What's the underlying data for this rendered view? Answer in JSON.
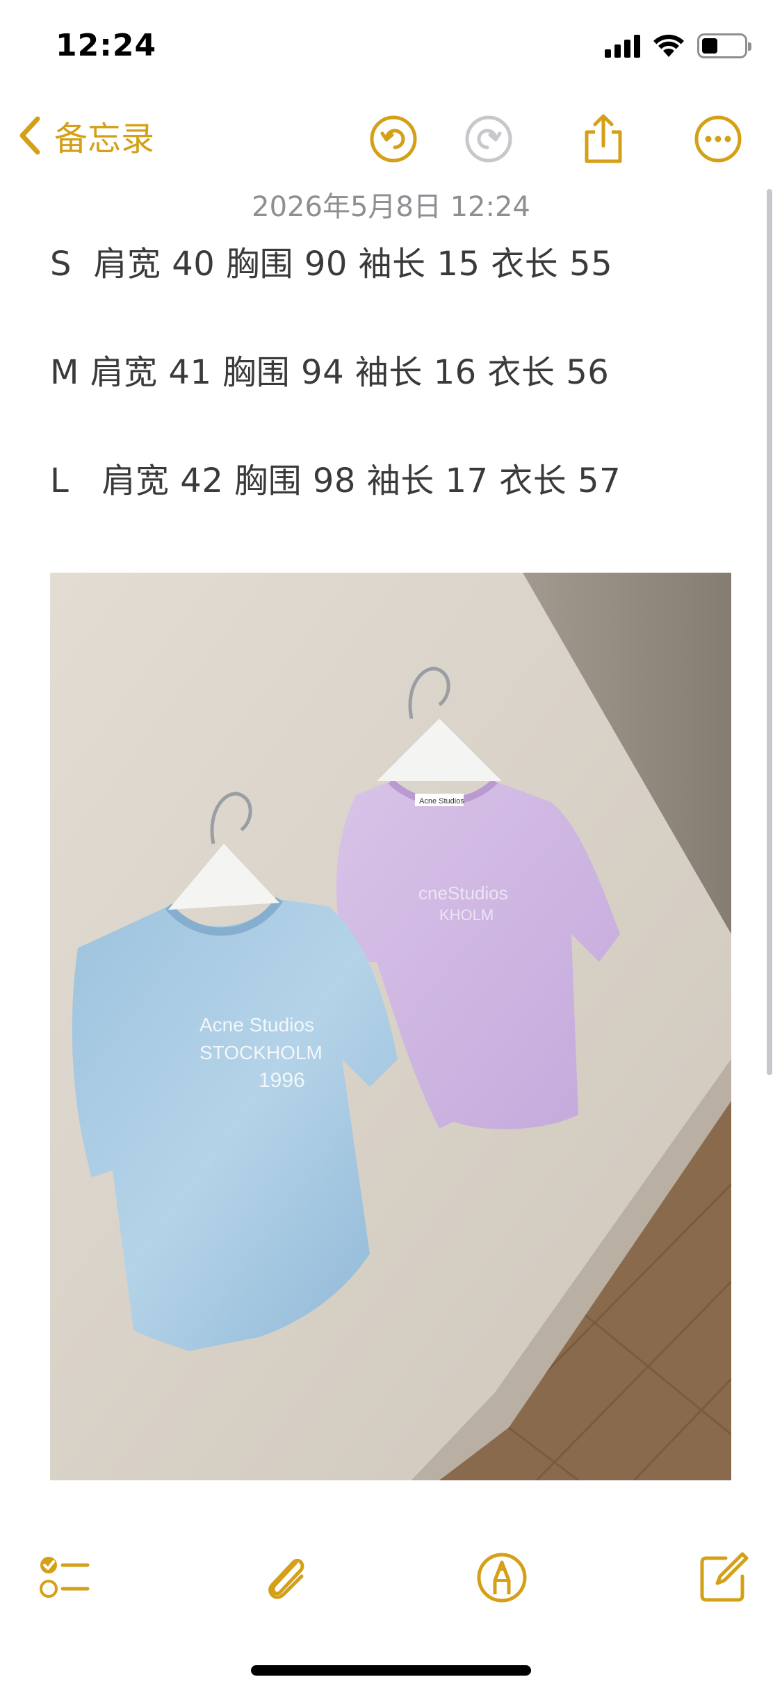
{
  "status_bar": {
    "time": "12:24",
    "icons": [
      "cellular-signal-icon",
      "wifi-icon",
      "battery-icon"
    ]
  },
  "nav": {
    "back_label": "备忘录",
    "back_icon": "chevron-left-icon",
    "buttons": [
      "undo-icon",
      "redo-icon",
      "share-icon",
      "more-icon"
    ]
  },
  "note": {
    "date": "2026年5月8日 12:24",
    "lines": [
      "S  肩宽 40 胸围 90 袖长 15 衣长 55",
      "M 肩宽 41 胸围 94 袖长 16 衣长 56",
      "L   肩宽 42 胸围 98 袖长 17 衣长 57"
    ],
    "photo": {
      "subject": "two t-shirts on hangers",
      "print_text": [
        "Acne Studios",
        "STOCKHOLM",
        "1996"
      ],
      "label_text": "Acne Studios"
    }
  },
  "toolbar": {
    "buttons": [
      "checklist-icon",
      "attachment-icon",
      "markup-icon",
      "compose-icon"
    ]
  },
  "colors": {
    "accent": "#d4a017",
    "text": "#3a3a3c",
    "secondary_text": "#8e8e93",
    "disabled": "#c7c7cc"
  }
}
